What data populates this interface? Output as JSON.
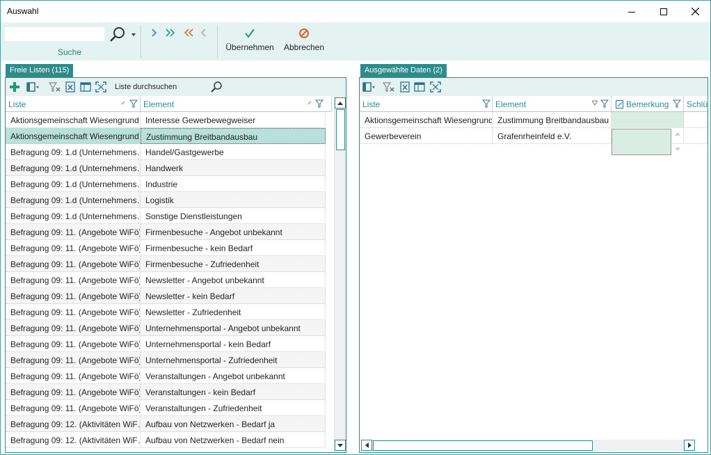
{
  "window": {
    "title": "Auswahl"
  },
  "ribbon": {
    "search_value": "",
    "search_label": "Suche",
    "ok_label": "Übernehmen",
    "cancel_label": "Abbrechen",
    "colors": {
      "accent": "#2e8b8b",
      "ribbon_bg": "#e4f3f1",
      "ok_green": "#1a9a7a",
      "cancel_orange": "#e06020"
    }
  },
  "left": {
    "tab": "Freie Listen (115)",
    "search_label": "Liste durchsuchen",
    "columns": [
      "Liste",
      "Element"
    ],
    "rows": [
      [
        "Aktionsgemeinschaft Wiesengrund",
        "Interesse Gewerbewegweiser"
      ],
      [
        "Aktionsgemeinschaft Wiesengrund",
        "Zustimmung Breitbandausbau"
      ],
      [
        "Befragung 09: 1.d (Unternehmens…",
        "Handel/Gastgewerbe"
      ],
      [
        "Befragung 09: 1.d (Unternehmens…",
        "Handwerk"
      ],
      [
        "Befragung 09: 1.d (Unternehmens…",
        "Industrie"
      ],
      [
        "Befragung 09: 1.d (Unternehmens…",
        "Logistik"
      ],
      [
        "Befragung 09: 1.d (Unternehmens…",
        "Sonstige Dienstleistungen"
      ],
      [
        "Befragung 09: 11. (Angebote WiFö)",
        "Firmenbesuche - Angebot unbekannt"
      ],
      [
        "Befragung 09: 11. (Angebote WiFö)",
        "Firmenbesuche - kein Bedarf"
      ],
      [
        "Befragung 09: 11. (Angebote WiFö)",
        "Firmenbesuche - Zufriedenheit"
      ],
      [
        "Befragung 09: 11. (Angebote WiFö)",
        "Newsletter - Angebot unbekannt"
      ],
      [
        "Befragung 09: 11. (Angebote WiFö)",
        "Newsletter - kein Bedarf"
      ],
      [
        "Befragung 09: 11. (Angebote WiFö)",
        "Newsletter - Zufriedenheit"
      ],
      [
        "Befragung 09: 11. (Angebote WiFö)",
        "Unternehmensportal - Angebot unbekannt"
      ],
      [
        "Befragung 09: 11. (Angebote WiFö)",
        "Unternehmensportal - kein Bedarf"
      ],
      [
        "Befragung 09: 11. (Angebote WiFö)",
        "Unternehmensportal - Zufriedenheit"
      ],
      [
        "Befragung 09: 11. (Angebote WiFö)",
        "Veranstaltungen - Angebot unbekannt"
      ],
      [
        "Befragung 09: 11. (Angebote WiFö)",
        "Veranstaltungen - kein Bedarf"
      ],
      [
        "Befragung 09: 11. (Angebote WiFö)",
        "Veranstaltungen - Zufriedenheit"
      ],
      [
        "Befragung 09: 12. (Aktivitäten WiF…",
        "Aufbau von Netzwerken - Bedarf ja"
      ],
      [
        "Befragung 09: 12. (Aktivitäten WiF…",
        "Aufbau von Netzwerken - Bedarf nein"
      ]
    ],
    "selected_row": 1
  },
  "right": {
    "tab": "Ausgewählte Daten (2)",
    "columns": [
      "Liste",
      "Element",
      "Bemerkung",
      "Schlüs"
    ],
    "rows": [
      [
        "Aktionsgemeinschaft Wiesengrund",
        "Zustimmung Breitbandausbau",
        "",
        ""
      ],
      [
        "Gewerbeverein",
        "Grafenrheinfeld e.V.",
        "",
        ""
      ]
    ]
  }
}
